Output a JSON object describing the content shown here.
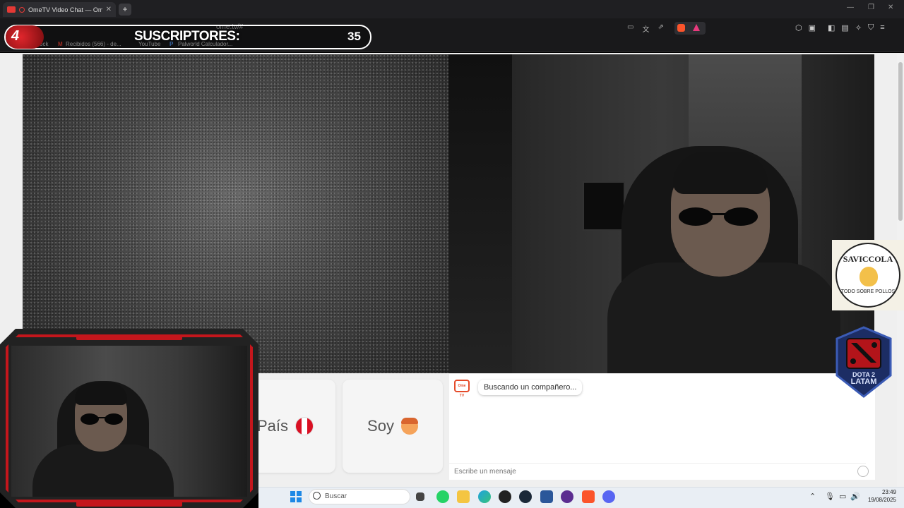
{
  "browser": {
    "tab_title": "OmeTV Video Chat — Omeg",
    "tab_close": "✕",
    "new_tab": "+",
    "url": "ome.tv/#",
    "bookmarks": [
      "ock",
      "Recibidos (566) - de...",
      "YouTube",
      "Palworld Calculador..."
    ]
  },
  "overlay": {
    "subs_label": "SUSCRIPTORES:",
    "subs_value": "35",
    "counter": "4"
  },
  "buttons": {
    "country_label": "País",
    "gender_label": "Soy"
  },
  "chat": {
    "logo_text": "Ome TV",
    "status_message": "Buscando un compañero...",
    "input_placeholder": "Escribe un mensaje"
  },
  "sponsors": {
    "saviccola_title": "SAVICCOLA",
    "saviccola_sub": "TODO SOBRE POLLOS",
    "dota_line1": "DOTA 2",
    "dota_line2": "LATAM"
  },
  "taskbar": {
    "search_placeholder": "Buscar",
    "time": "23:49",
    "date": "19/08/2025",
    "apps": [
      "file-explorer",
      "whatsapp",
      "folder",
      "edge",
      "obs",
      "steam",
      "word",
      "streaming-app",
      "brave",
      "discord"
    ]
  },
  "colors": {
    "accent_red": "#c4161c",
    "ometv_orange": "#e54b2a"
  }
}
